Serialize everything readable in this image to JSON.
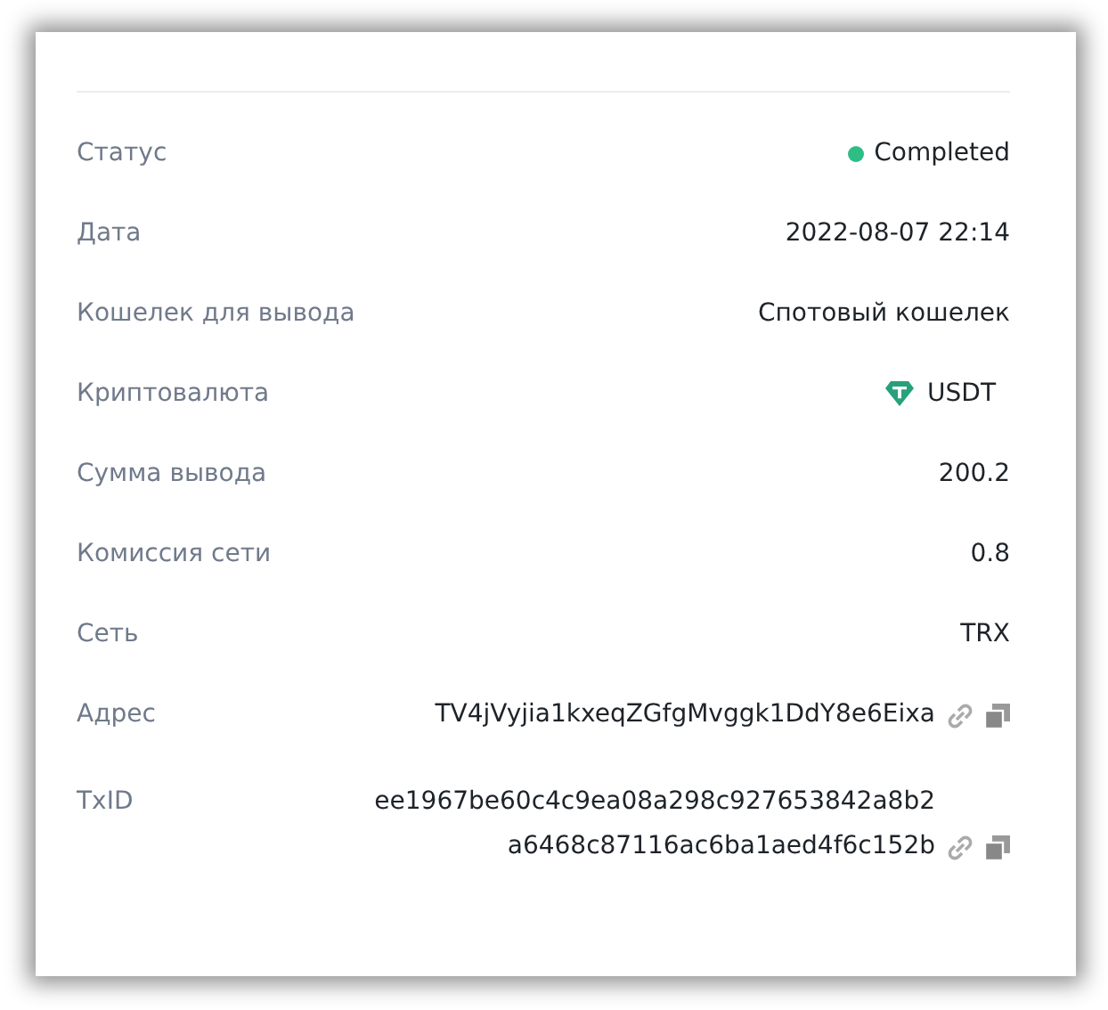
{
  "rows": [
    {
      "kind": "status",
      "label": "Статус",
      "value": "Completed",
      "color": "#2ebd85"
    },
    {
      "kind": "text",
      "label": "Дата",
      "value": "2022-08-07 22:14"
    },
    {
      "kind": "text",
      "label": "Кошелек для вывода",
      "value": "Спотовый кошелек"
    },
    {
      "kind": "coin",
      "label": "Криптовалюта",
      "value": "USDT"
    },
    {
      "kind": "text",
      "label": "Сумма вывода",
      "value": "200.2"
    },
    {
      "kind": "text",
      "label": "Комиссия сети",
      "value": "0.8"
    },
    {
      "kind": "text",
      "label": "Сеть",
      "value": "TRX"
    },
    {
      "kind": "hash",
      "label": "Адрес",
      "value": "TV4jVyjia1kxeqZGfgMvggk1DdY8e6Eixa"
    },
    {
      "kind": "hash",
      "label": "TxID",
      "value": "ee1967be60c4c9ea08a298c927653842a8b2a6468c87116ac6ba1aed4f6c152b"
    }
  ]
}
